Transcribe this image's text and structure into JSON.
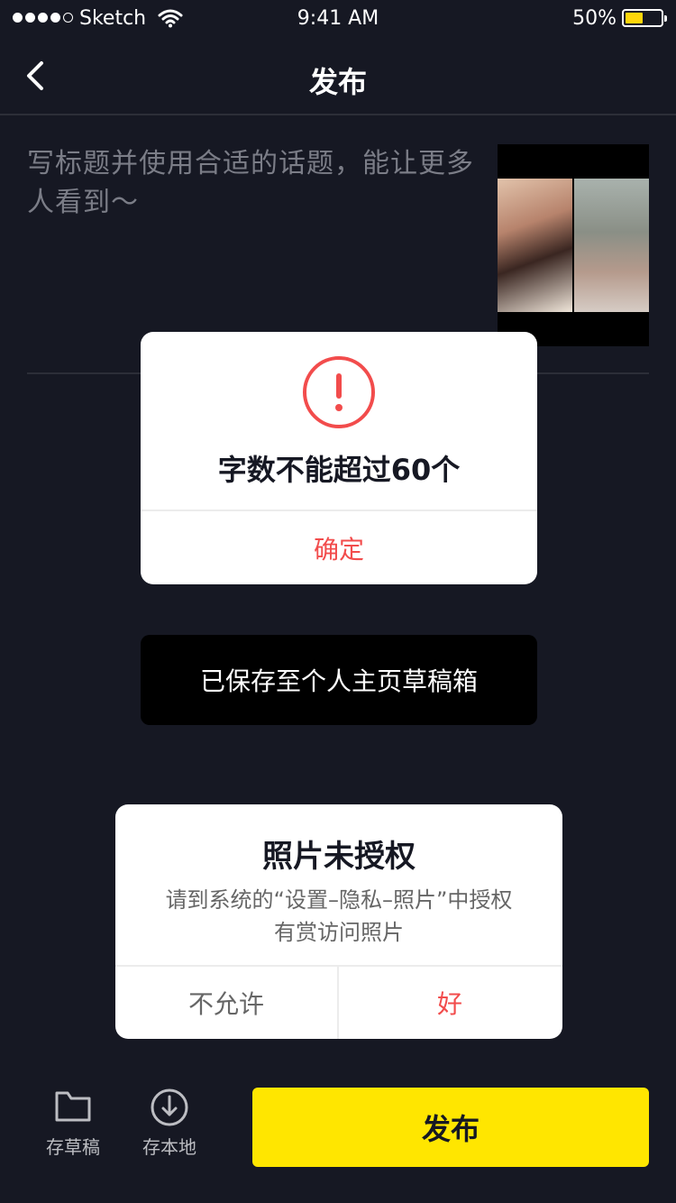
{
  "status_bar": {
    "carrier": "Sketch",
    "time": "9:41 AM",
    "battery_percent": "50%",
    "battery_level": 0.5
  },
  "nav": {
    "title": "发布",
    "back_icon": "chevron-left-icon"
  },
  "editor": {
    "caption_placeholder": "写标题并使用合适的话题，能让更多人看到～"
  },
  "alert": {
    "icon": "exclamation-circle-icon",
    "message": "字数不能超过60个",
    "confirm_label": "确定"
  },
  "toast": {
    "message": "已保存至个人主页草稿箱"
  },
  "permission_dialog": {
    "title": "照片未授权",
    "body_line1": "请到系统的“设置–隐私–照片”中授权",
    "body_line2": "有赏访问照片",
    "deny_label": "不允许",
    "allow_label": "好"
  },
  "bottom_bar": {
    "draft_label": "存草稿",
    "draft_icon": "folder-icon",
    "local_label": "存本地",
    "local_icon": "download-icon",
    "publish_label": "发布"
  },
  "colors": {
    "background": "#161823",
    "accent_red": "#f24c4c",
    "publish_yellow": "#ffe600"
  }
}
